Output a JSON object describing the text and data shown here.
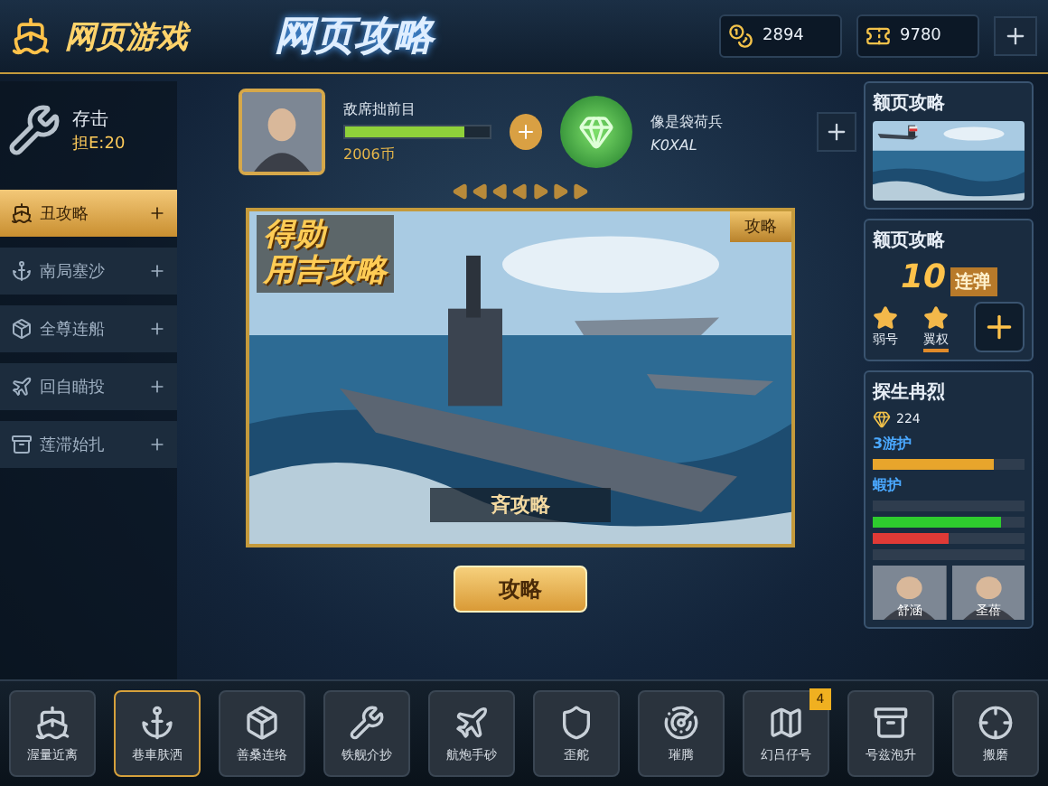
{
  "header": {
    "logo": "网页游戏",
    "title": "网页攻略",
    "currencies": [
      {
        "kind": "gold",
        "amount": "2894"
      },
      {
        "kind": "ticket",
        "amount": "9780"
      }
    ]
  },
  "player": {
    "name": "存击",
    "level": "担E:20"
  },
  "sidebar": [
    {
      "label": "丑攻略",
      "selected": true
    },
    {
      "label": "南局塞沙",
      "selected": false
    },
    {
      "label": "全尊连船",
      "selected": false
    },
    {
      "label": "回自瞄投",
      "selected": false
    },
    {
      "label": "莲滞始扎",
      "selected": false
    }
  ],
  "hero": {
    "name": "敌席拙前目",
    "level": 0.82,
    "coins": "2006币"
  },
  "item": {
    "name": "像是袋荷兵",
    "code": "K0XAL"
  },
  "banner": {
    "title_lines": [
      "得勋",
      "用吉攻略"
    ],
    "tag": "攻略",
    "caption": "斉攻略"
  },
  "action_button": "攻略",
  "right": {
    "news": {
      "title": "额页攻略"
    },
    "promo": {
      "title": "额页攻略",
      "count": "10",
      "badge": "连弹",
      "buttons": [
        {
          "label": "弱号",
          "selected": false
        },
        {
          "label": "翼权",
          "selected": true
        }
      ]
    },
    "stats": {
      "title": "探生冉烈",
      "points": "224",
      "rows": [
        {
          "kind": "label",
          "text": "3游护"
        },
        {
          "kind": "bar",
          "color": "#e8a52c",
          "level": 0.8
        },
        {
          "kind": "label",
          "text": "蝦护"
        },
        {
          "kind": "track"
        },
        {
          "kind": "bar",
          "color": "#2ecc2e",
          "level": 0.85
        },
        {
          "kind": "bar",
          "color": "#e03a36",
          "level": 0.5
        },
        {
          "kind": "track"
        }
      ],
      "players": [
        "舒涵",
        "圣蓓"
      ]
    }
  },
  "dock": [
    {
      "label": "渥量近离",
      "selected": false
    },
    {
      "label": "巷車肤洒",
      "selected": true
    },
    {
      "label": "善桑连络",
      "selected": false
    },
    {
      "label": "铁舰介抄",
      "selected": false
    },
    {
      "label": "航炮手砂",
      "selected": false
    },
    {
      "label": "歪舵",
      "selected": false
    },
    {
      "label": "璀腾",
      "selected": false
    },
    {
      "label": "幻吕仔号",
      "selected": false,
      "badge": "4"
    },
    {
      "label": "号兹泡升",
      "selected": false
    },
    {
      "label": "搬磨",
      "selected": false
    }
  ]
}
